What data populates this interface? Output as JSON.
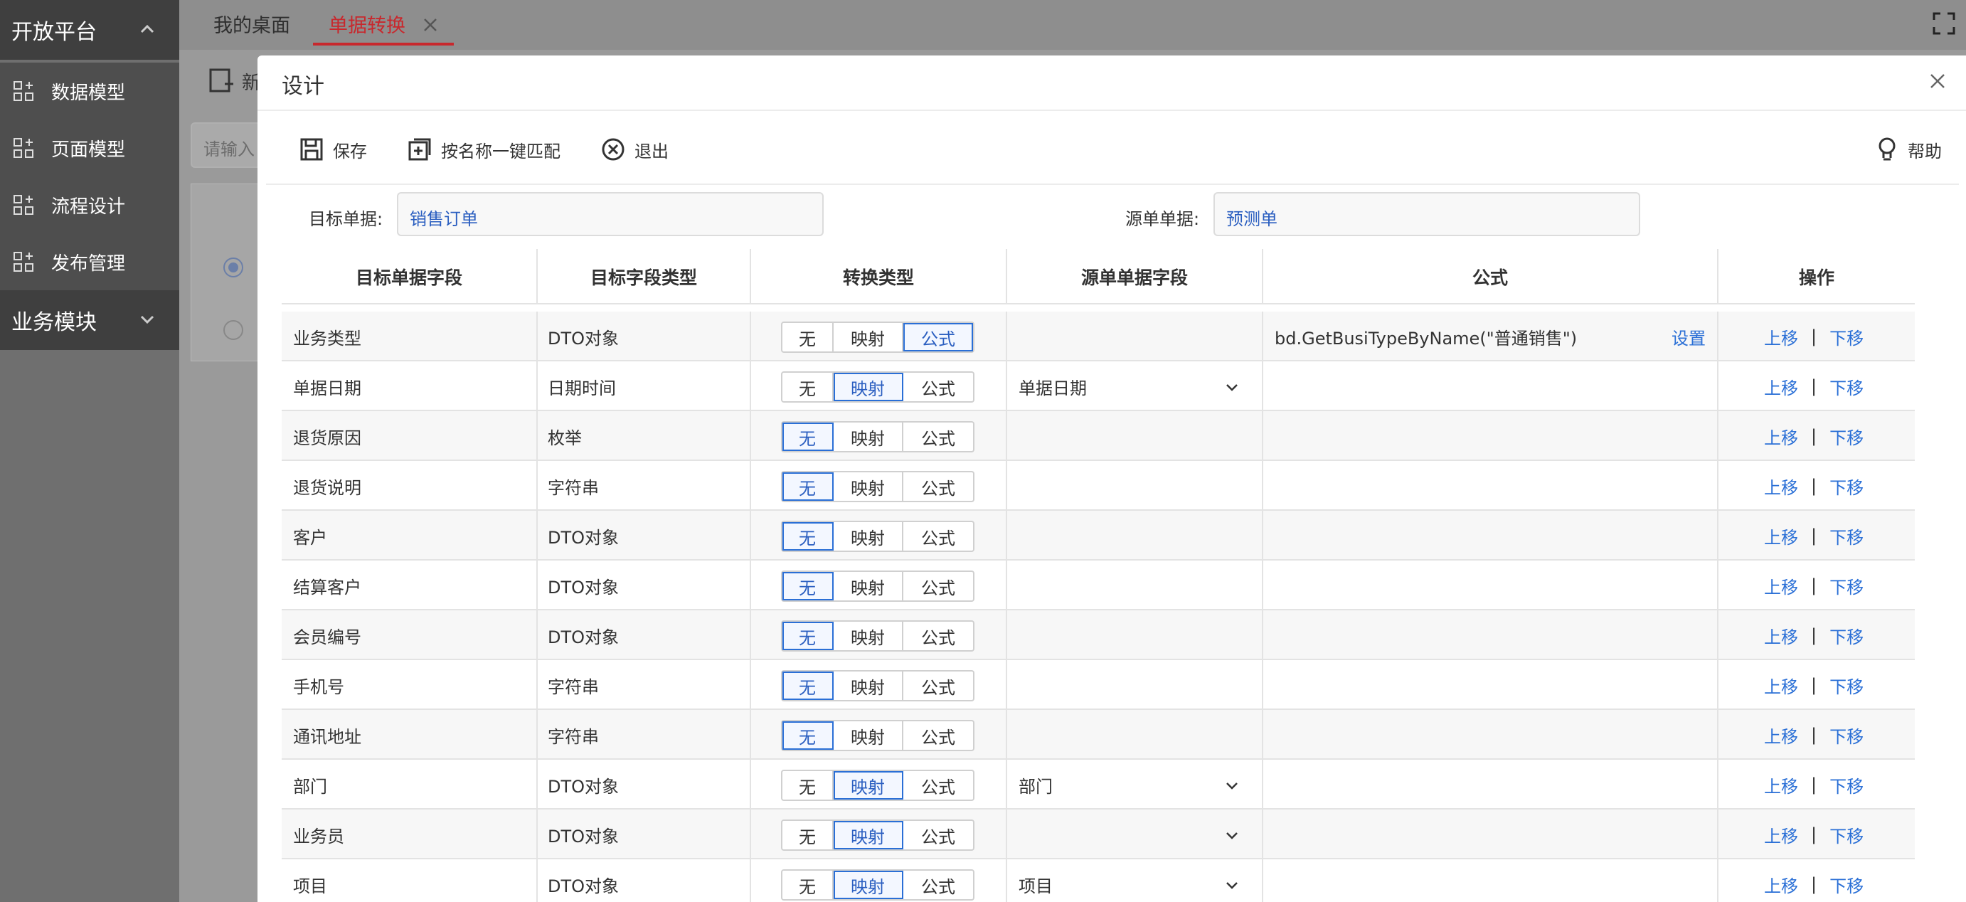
{
  "sidebar": {
    "group1": "开放平台",
    "items": [
      "数据模型",
      "页面模型",
      "流程设计",
      "发布管理"
    ],
    "group2": "业务模块"
  },
  "tabs": {
    "home": "我的桌面",
    "active": "单据转换"
  },
  "background": {
    "new_label": "新",
    "search_placeholder": "请输入"
  },
  "dialog": {
    "title": "设计",
    "toolbar": {
      "save": "保存",
      "match": "按名称一键匹配",
      "exit": "退出",
      "help": "帮助"
    },
    "target_label": "目标单据:",
    "target_value": "销售订单",
    "source_label": "源单单据:",
    "source_value": "预测单"
  },
  "table": {
    "headers": [
      "目标单据字段",
      "目标字段类型",
      "转换类型",
      "源单单据字段",
      "公式",
      "操作"
    ],
    "conv_options": [
      "无",
      "映射",
      "公式"
    ],
    "formula_set": "设置",
    "op_up": "上移",
    "op_sep": "|",
    "op_down": "下移",
    "rows": [
      {
        "field": "业务类型",
        "type": "DTO对象",
        "conv": "公式",
        "source": "",
        "formula": "bd.GetBusiTypeByName(\"普通销售\")"
      },
      {
        "field": "单据日期",
        "type": "日期时间",
        "conv": "映射",
        "source": "单据日期",
        "formula": ""
      },
      {
        "field": "退货原因",
        "type": "枚举",
        "conv": "无",
        "source": "",
        "formula": ""
      },
      {
        "field": "退货说明",
        "type": "字符串",
        "conv": "无",
        "source": "",
        "formula": ""
      },
      {
        "field": "客户",
        "type": "DTO对象",
        "conv": "无",
        "source": "",
        "formula": ""
      },
      {
        "field": "结算客户",
        "type": "DTO对象",
        "conv": "无",
        "source": "",
        "formula": ""
      },
      {
        "field": "会员编号",
        "type": "DTO对象",
        "conv": "无",
        "source": "",
        "formula": ""
      },
      {
        "field": "手机号",
        "type": "字符串",
        "conv": "无",
        "source": "",
        "formula": ""
      },
      {
        "field": "通讯地址",
        "type": "字符串",
        "conv": "无",
        "source": "",
        "formula": ""
      },
      {
        "field": "部门",
        "type": "DTO对象",
        "conv": "映射",
        "source": "部门",
        "formula": ""
      },
      {
        "field": "业务员",
        "type": "DTO对象",
        "conv": "映射",
        "source": "",
        "formula": ""
      },
      {
        "field": "项目",
        "type": "DTO对象",
        "conv": "映射",
        "source": "项目",
        "formula": ""
      }
    ]
  },
  "colors": {
    "accent": "#2a6fd6",
    "active_tab": "#c8282d",
    "sidebar_dark": "#3f3f3f"
  }
}
